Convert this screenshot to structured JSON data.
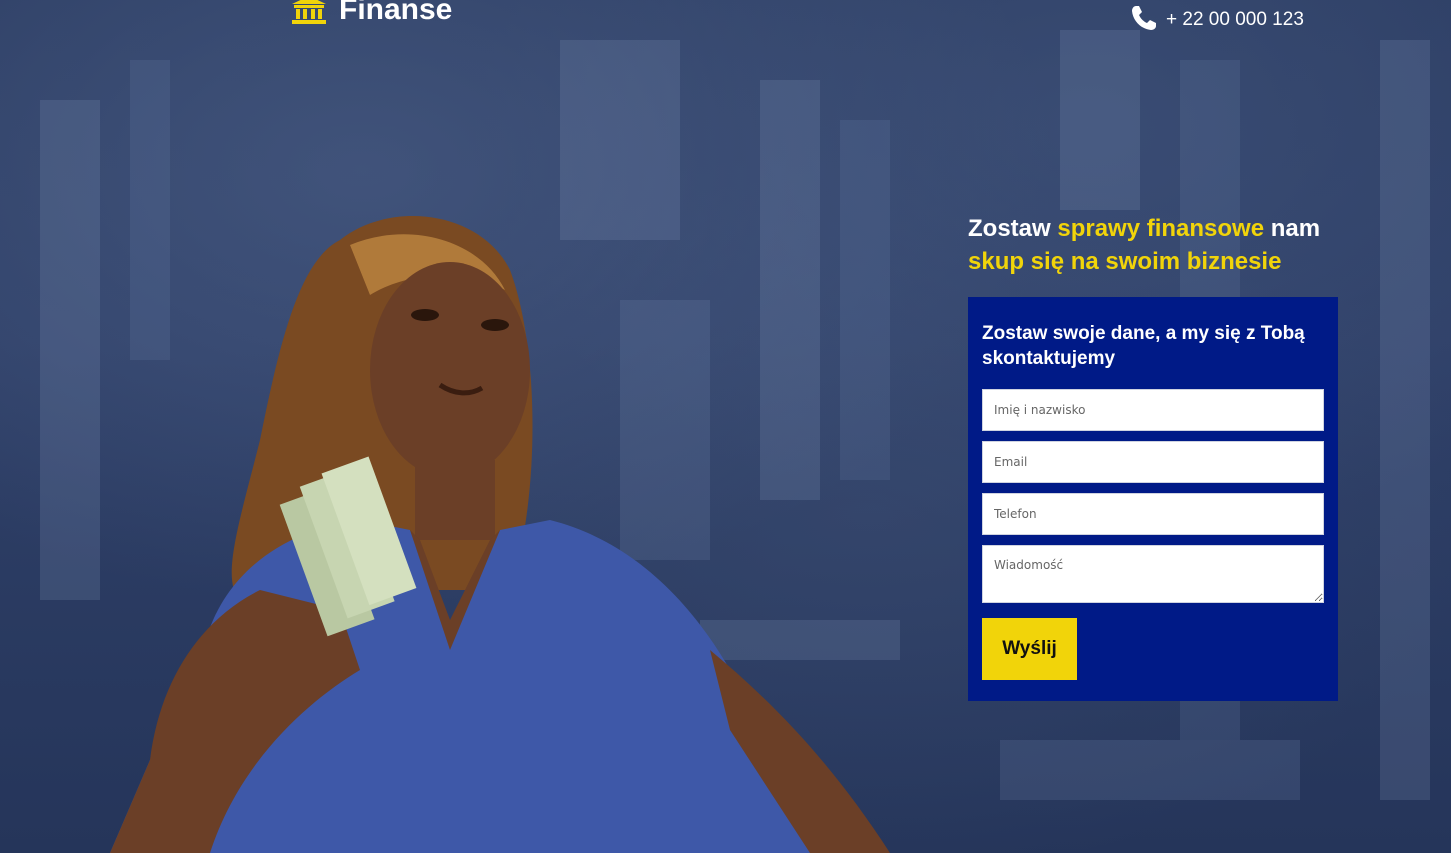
{
  "header": {
    "logo_text": "Finanse",
    "logo_icon": "bank-icon",
    "phone_icon": "phone-icon",
    "phone": "+ 22 00 000 123"
  },
  "hero": {
    "headline_part1": "Zostaw ",
    "headline_highlight1": "sprawy finansowe",
    "headline_part2": " nam",
    "headline_highlight2": "skup się na swoim biznesie"
  },
  "form": {
    "title": "Zostaw swoje dane, a my się z Tobą skontaktujemy",
    "name_placeholder": "Imię i nazwisko",
    "email_placeholder": "Email",
    "phone_placeholder": "Telefon",
    "message_placeholder": "Wiadomość",
    "submit_label": "Wyślij"
  },
  "colors": {
    "accent": "#f1d40a",
    "form_bg": "#001a87",
    "page_bg": "#2a3a5e"
  }
}
